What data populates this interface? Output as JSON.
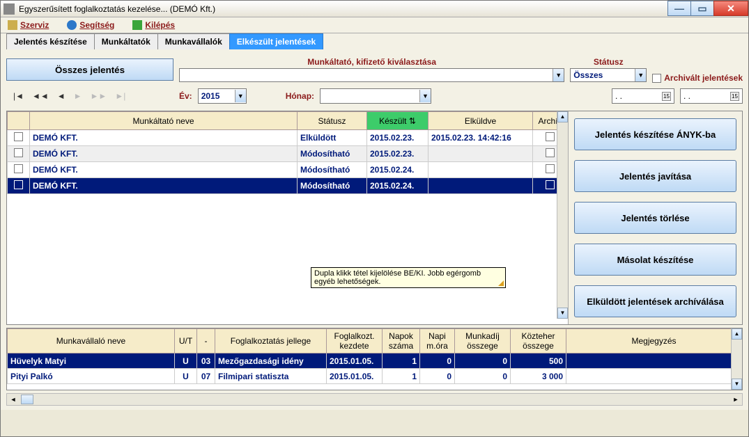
{
  "window": {
    "title": "Egyszerűsített foglalkoztatás kezelése... (DEMÓ Kft.)"
  },
  "menu": {
    "szerviz": "Szerviz",
    "segitseg": "Segítség",
    "kilepes": "Kilépés"
  },
  "tabs": {
    "t1": "Jelentés készítése",
    "t2": "Munkáltatók",
    "t3": "Munkavállalók",
    "t4": "Elkészült jelentések"
  },
  "filters": {
    "all_btn": "Összes jelentés",
    "employer_lbl": "Munkáltató, kifizető  kiválasztása",
    "status_lbl": "Státusz",
    "status_val": "Összes",
    "archived_lbl": "Archivált jelentések",
    "year_lbl": "Év:",
    "year_val": "2015",
    "month_lbl": "Hónap:",
    "date1": ". .",
    "date2": ". ."
  },
  "table1": {
    "headers": [
      "",
      "Munkáltató neve",
      "Státusz",
      "Készült",
      "Elküldve",
      "Archív"
    ],
    "sort_glyph": "⇅",
    "rows": [
      {
        "name": "DEMÓ KFT.",
        "status": "Elküldött",
        "created": "2015.02.23.",
        "sent": "2015.02.23. 14:42:16",
        "selected": false,
        "striped": false
      },
      {
        "name": "DEMÓ KFT.",
        "status": "Módosítható",
        "created": "2015.02.23.",
        "sent": "",
        "selected": false,
        "striped": true
      },
      {
        "name": "DEMÓ KFT.",
        "status": "Módosítható",
        "created": "2015.02.24.",
        "sent": "",
        "selected": false,
        "striped": false
      },
      {
        "name": "DEMÓ KFT.",
        "status": "Módosítható",
        "created": "2015.02.24.",
        "sent": "",
        "selected": true,
        "striped": false
      }
    ]
  },
  "tooltip": "Dupla klikk tétel kijelölése BE/KI. Jobb egérgomb egyéb lehetőségek.",
  "side": {
    "b1": "Jelentés készítése ÁNYK-ba",
    "b2": "Jelentés javítása",
    "b3": "Jelentés törlése",
    "b4": "Másolat készítése",
    "b5": "Elküldött jelentések archíválása"
  },
  "table2": {
    "headers": [
      "Munkavállaló neve",
      "U/T",
      "-",
      "Foglalkoztatás jellege",
      "Foglalkozt. kezdete",
      "Napok száma",
      "Napi m.óra",
      "Munkadíj összege",
      "Közteher összege",
      "Megjegyzés"
    ],
    "rows": [
      {
        "name": "Hüvelyk Matyi",
        "ut": "U",
        "dash": "03",
        "type": "Mezőgazdasági idény",
        "start": "2015.01.05.",
        "days": "1",
        "hours": "0",
        "wage": "0",
        "tax": "500",
        "note": "",
        "selected": true
      },
      {
        "name": "Pityi Palkó",
        "ut": "U",
        "dash": "07",
        "type": "Filmipari statiszta",
        "start": "2015.01.05.",
        "days": "1",
        "hours": "0",
        "tax": "3 000",
        "wage": "0",
        "note": "",
        "selected": false
      }
    ]
  }
}
